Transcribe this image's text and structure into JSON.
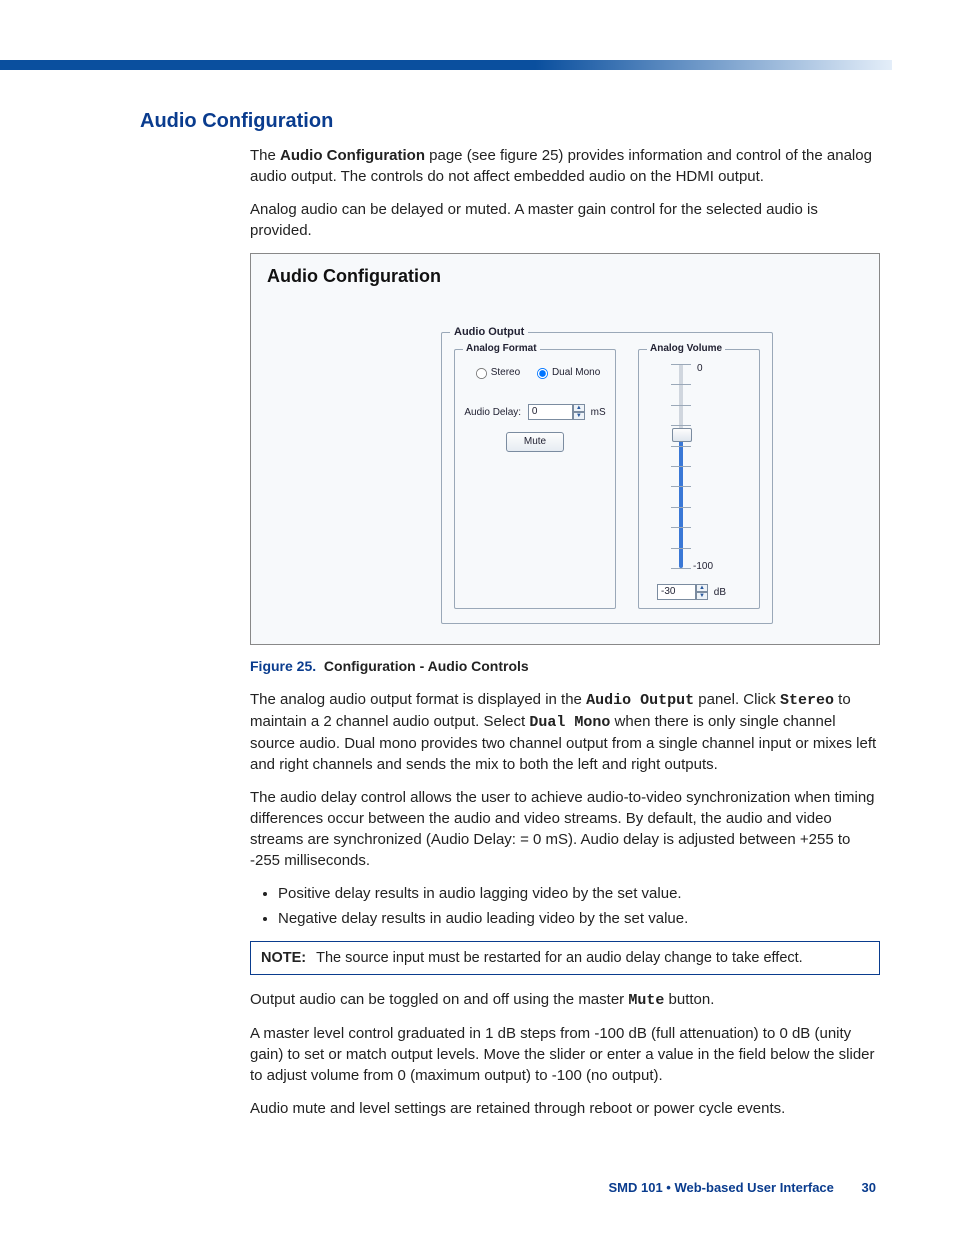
{
  "section_heading": "Audio Configuration",
  "intro_p1_a": "The ",
  "intro_p1_bold": "Audio Configuration",
  "intro_p1_b": " page (see figure 25) provides information and control of the analog audio output. The controls do not affect embedded audio on the HDMI output.",
  "intro_p2": "Analog audio can be delayed or muted. A master gain control for the selected audio is provided.",
  "shot": {
    "panel_title": "Audio Configuration",
    "group_label": "Audio Output",
    "analog_format": {
      "label": "Analog Format",
      "radio_stereo": "Stereo",
      "radio_dualmono": "Dual Mono",
      "delay_label": "Audio Delay:",
      "delay_value": "0",
      "delay_unit": "mS",
      "mute_label": "Mute"
    },
    "analog_volume": {
      "label": "Analog Volume",
      "top_value": "0",
      "bottom_value": "-100",
      "field_value": "-30",
      "field_unit": "dB"
    }
  },
  "figure": {
    "num": "Figure 25.",
    "title": "Configuration - Audio Controls"
  },
  "p3_a": "The analog audio output format is displayed in the ",
  "p3_mono1": "Audio Output",
  "p3_b": " panel. Click ",
  "p3_mono2": "Stereo",
  "p3_c": " to maintain a 2 channel audio output. Select ",
  "p3_mono3": "Dual Mono",
  "p3_d": " when there is only single channel source audio. Dual mono provides two channel output from a single channel input or mixes left and right channels and sends the mix to both the left and right outputs.",
  "p4": "The audio delay control allows the user to achieve audio-to-video synchronization when timing differences occur between the audio and video streams. By default, the audio and video streams are synchronized (Audio Delay: = 0 mS). Audio delay is adjusted between +255 to -255 milliseconds.",
  "bullets": [
    "Positive delay results in audio lagging video by the set value.",
    "Negative delay results in audio leading video by the set value."
  ],
  "note_label": "NOTE:",
  "note_text": "The source input must be restarted for an audio delay change to take effect.",
  "p5_a": "Output audio can be toggled on and off using the master ",
  "p5_mono": "Mute",
  "p5_b": " button.",
  "p6": "A master level control graduated in 1 dB steps from -100 dB (full attenuation) to 0 dB (unity gain) to set or match output levels. Move the slider or enter a value in the field below the slider to adjust volume from 0 (maximum output) to -100 (no output).",
  "p7": "Audio mute and level settings are retained through reboot or power cycle events.",
  "footer": {
    "text": "SMD 101 • Web-based User Interface",
    "page": "30"
  }
}
